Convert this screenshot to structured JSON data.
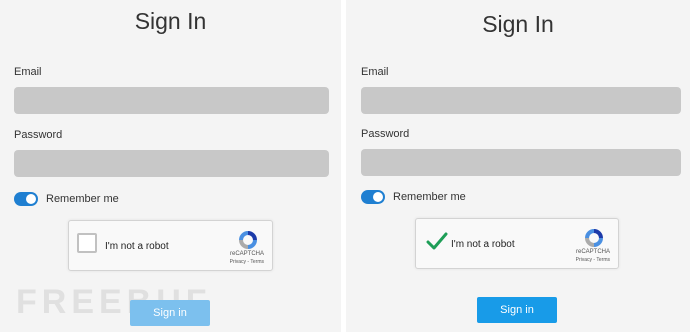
{
  "left": {
    "title": "Sign In",
    "email_label": "Email",
    "password_label": "Password",
    "remember_label": "Remember me",
    "remember_on": true,
    "captcha": {
      "text": "I'm not a robot",
      "checked": false,
      "brand": "reCAPTCHA",
      "links": "Privacy - Terms"
    },
    "signin_label": "Sign in",
    "watermark": "FREEBUF"
  },
  "right": {
    "title": "Sign In",
    "email_label": "Email",
    "password_label": "Password",
    "remember_label": "Remember me",
    "remember_on": true,
    "captcha": {
      "text": "I'm not a robot",
      "checked": true,
      "brand": "reCAPTCHA",
      "links": "Privacy - Terms"
    },
    "signin_label": "Sign in"
  },
  "colors": {
    "panel_bg": "#f4f4f4",
    "input_bg": "#c8c8c8",
    "toggle_accent": "#1f7fd1",
    "signin_disabled": "#7cc0ee",
    "signin_enabled": "#189be8",
    "check_green": "#1e9e57"
  },
  "icons": [
    "recaptcha-logo-icon",
    "checkmark-icon",
    "toggle-switch"
  ]
}
